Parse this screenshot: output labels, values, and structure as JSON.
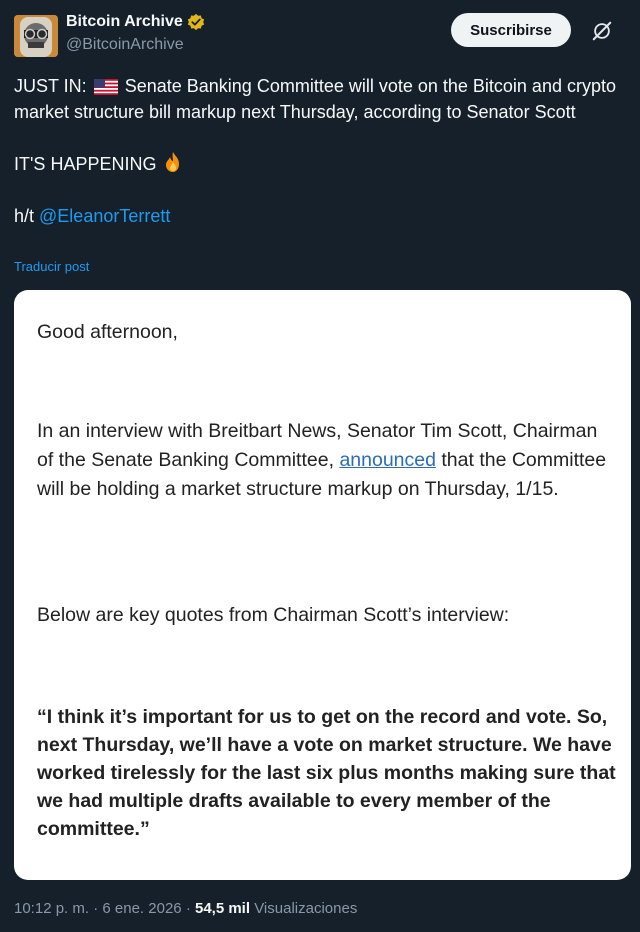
{
  "author": {
    "display_name": "Bitcoin Archive",
    "handle": "@BitcoinArchive"
  },
  "actions": {
    "subscribe_label": "Suscribirse"
  },
  "tweet": {
    "line1_prefix": "JUST IN:",
    "line1_text": "Senate Banking Committee will vote on the Bitcoin and crypto market structure bill markup next Thursday, according to Senator Scott",
    "line2": "IT'S HAPPENING",
    "ht_prefix": "h/t",
    "mention": "@EleanorTerrett",
    "translate_label": "Traducir post"
  },
  "card": {
    "greeting": "Good afternoon,",
    "p1_before": "In an interview with Breitbart News, Senator Tim Scott, Chairman of the Senate Banking Committee,",
    "p1_link": "announced",
    "p1_after": "that the Committee will be holding a market structure markup on Thursday, 1/15.",
    "p2": "Below are key quotes from Chairman Scott’s interview:",
    "quote": "“I think it’s important for us to get on the record and vote. So, next Thursday, we’ll have a vote on market structure. We have worked tirelessly for the last six plus months making sure that we had multiple drafts available to every member of the committee.”"
  },
  "footer": {
    "time": "10:12 p. m.",
    "sep": "·",
    "date": "6 ene. 2026",
    "views_count": "54,5 mil",
    "views_label": "Visualizaciones"
  },
  "icons": {
    "verified": "verified-badge-icon",
    "grok": "grok-icon",
    "flag": "us-flag-icon",
    "fire": "fire-icon"
  },
  "colors": {
    "background": "#15202b",
    "link": "#1d9bf0",
    "verified": "#e2b719"
  }
}
